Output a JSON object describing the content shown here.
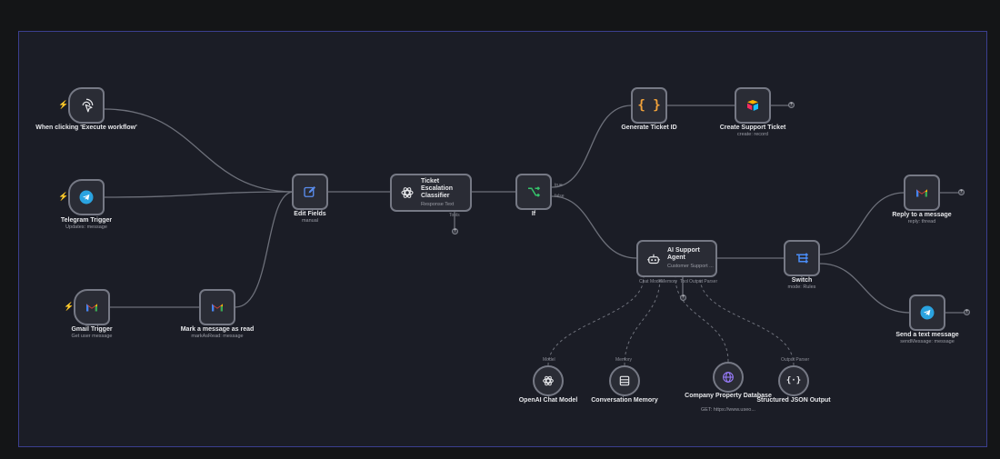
{
  "colors": {
    "background": "#141517",
    "canvas": "#1b1d26",
    "node_fill": "#2a2c35",
    "node_border": "#767985",
    "selection_border": "#3b3f8f",
    "trigger_bolt": "#ff6d3b",
    "telegram_blue": "#2aa3e0",
    "switch_blue": "#4a8df8",
    "if_green": "#35c46b",
    "code_orange": "#f2a33a",
    "edit_blue": "#5a8dee"
  },
  "nodes": {
    "manual_trigger": {
      "title": "When clicking 'Execute workflow'",
      "icon": "cursor-click-icon"
    },
    "telegram_trigger": {
      "title": "Telegram Trigger",
      "subtitle": "Updates: message",
      "icon": "telegram-icon"
    },
    "gmail_trigger": {
      "title": "Gmail Trigger",
      "subtitle": "Get user message",
      "icon": "gmail-icon"
    },
    "mark_read": {
      "title": "Mark a message as read",
      "subtitle": "markAsRead: message",
      "icon": "gmail-icon"
    },
    "edit_fields": {
      "title": "Edit Fields",
      "subtitle": "manual",
      "icon": "pencil-square-icon"
    },
    "classifier": {
      "title": "Ticket Escalation Classifier",
      "subtitle": "Response Text",
      "port_label": "Tools",
      "icon": "openai-icon"
    },
    "if": {
      "title": "If",
      "true_label": "true",
      "false_label": "false",
      "icon": "branch-icon"
    },
    "gen_ticket": {
      "title": "Generate Ticket ID",
      "icon": "code-braces-icon"
    },
    "create_ticket": {
      "title": "Create Support Ticket",
      "subtitle": "create: record",
      "icon": "airtable-icon"
    },
    "ai_agent": {
      "title": "AI Support Agent",
      "subtitle": "Customer Support ...",
      "ports": [
        "Chat Model",
        "Memory",
        "Tool",
        "Output Parser"
      ],
      "icon": "robot-icon"
    },
    "switch": {
      "title": "Switch",
      "subtitle": "mode: Rules",
      "icon": "switch-icon"
    },
    "reply": {
      "title": "Reply to a message",
      "subtitle": "reply: thread",
      "icon": "gmail-icon"
    },
    "send_tg": {
      "title": "Send a text message",
      "subtitle": "sendMessage: message",
      "icon": "telegram-icon"
    },
    "openai_model": {
      "title": "OpenAI Chat Model",
      "tag": "Model",
      "icon": "openai-icon"
    },
    "memory": {
      "title": "Conversation Memory",
      "tag": "Memory",
      "icon": "database-icon"
    },
    "property_db": {
      "title": "Company Property Database",
      "subtitle": "GET: https://www.useo...",
      "icon": "globe-icon"
    },
    "json_parser": {
      "title": "Structured JSON Output",
      "tag": "Output Parser",
      "icon": "json-braces-icon"
    }
  }
}
